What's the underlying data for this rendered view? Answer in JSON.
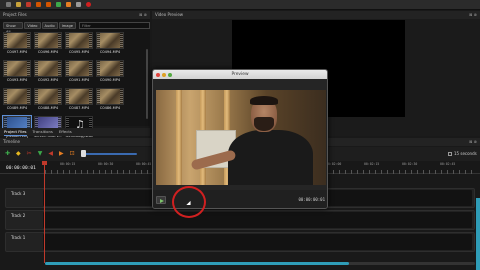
{
  "project_files": {
    "title": "Project Files",
    "header_controls": "⊠ ⊗",
    "filters": [
      "Show All",
      "Video",
      "Audio",
      "Image"
    ],
    "filter_placeholder": "Filter",
    "items": [
      {
        "name": "C0497.MP4"
      },
      {
        "name": "C0496.MP4"
      },
      {
        "name": "C0495.MP4"
      },
      {
        "name": "C0494.MP4"
      },
      {
        "name": "C0493.MP4"
      },
      {
        "name": "C0492.MP4"
      },
      {
        "name": "C0491.MP4"
      },
      {
        "name": "C0490.MP4"
      },
      {
        "name": "C0489.MP4"
      },
      {
        "name": "C0488.MP4"
      },
      {
        "name": "C0487.MP4"
      },
      {
        "name": "C0486.MP4"
      },
      {
        "name": "[REDACTED]"
      },
      {
        "name": "Screen Shot 2..."
      },
      {
        "name": "Technology.wav"
      }
    ]
  },
  "bottom_tabs": [
    "Project Files",
    "Transitions",
    "Effects"
  ],
  "video_preview": {
    "title": "Video Preview",
    "header_controls": "⊠ ⊗"
  },
  "preview_dialog": {
    "title": "Preview",
    "time": "00:00:00:01"
  },
  "timeline": {
    "title": "Timeline",
    "header_controls": "⊠ ⊗",
    "timecode": "00:00:00:01",
    "seconds_label": "15 seconds",
    "ruler_labels": [
      "00:00:15",
      "00:00:30",
      "00:00:45",
      "00:01:00",
      "00:01:15",
      "00:01:30",
      "00:01:45",
      "00:02:00",
      "00:02:15",
      "00:02:30",
      "00:02:45"
    ],
    "tracks": [
      {
        "label": "Track 3"
      },
      {
        "label": "Track 2"
      },
      {
        "label": "Track 1"
      }
    ],
    "zoom_level": 0.05,
    "scroll_position": 0.7
  },
  "colors": {
    "accent": "#2f9db8",
    "playhead": "#c0392b",
    "highlight": "#d02020"
  }
}
